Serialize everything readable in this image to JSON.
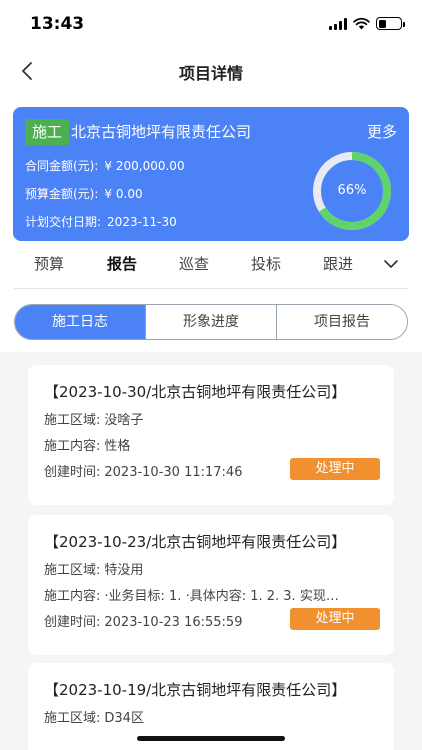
{
  "status_bar": {
    "time": "13:43",
    "battery_level": 0.35
  },
  "nav": {
    "title": "项目详情",
    "back_icon": "chevron-left-icon"
  },
  "project": {
    "tag": "施工",
    "company": "北京古铜地坪有限责任公司",
    "more": "更多",
    "contract_label": "合同金额(元):",
    "contract_value": "¥ 200,000.00",
    "budget_label": "预算金额(元):",
    "budget_value": "¥ 0.00",
    "delivery_label": "计划交付日期:",
    "delivery_value": "2023-11-30",
    "progress_label": "66%",
    "progress": 0.66,
    "colors": {
      "card": "#4b82f6",
      "tag": "#4caf50",
      "progress": "#5ed46b",
      "track": "#e8ebf0"
    }
  },
  "category_tabs": [
    "预算",
    "报告",
    "巡查",
    "投标",
    "跟进"
  ],
  "category_more_icon": "chevron-down-icon",
  "segments": [
    "施工日志",
    "形象进度",
    "项目报告"
  ],
  "records": [
    {
      "title": "【2023-10-30/北京古铜地坪有限责任公司】",
      "area_label": "施工区域:",
      "area": "没啥子",
      "content_label": "施工内容:",
      "content": "性格",
      "created_label": "创建时间:",
      "created": "2023-10-30 11:17:46",
      "status": "处理中"
    },
    {
      "title": "【2023-10-23/北京古铜地坪有限责任公司】",
      "area_label": "施工区域:",
      "area": "特没用",
      "content_label": "施工内容:",
      "content": "·业务目标: 1. ·具体内容: 1. 2. 3. 实现…",
      "created_label": "创建时间:",
      "created": "2023-10-23 16:55:59",
      "status": "处理中"
    },
    {
      "title": "【2023-10-19/北京古铜地坪有限责任公司】",
      "area_label": "施工区域:",
      "area": "D34区"
    }
  ],
  "colors": {
    "accent": "#4b82f6",
    "status_badge": "#f0902e"
  }
}
